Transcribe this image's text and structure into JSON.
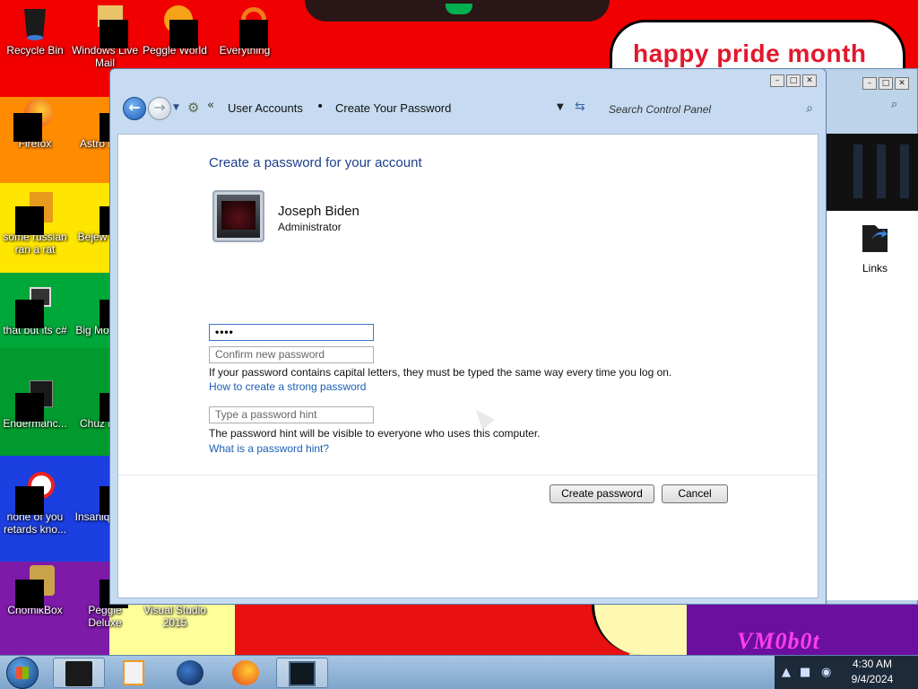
{
  "wallpaper": {
    "speech_text": "happy pride month",
    "corner_text": "VM0b0t"
  },
  "desktop_icons": [
    {
      "label": "Recycle Bin"
    },
    {
      "label": "Windows Live Mail"
    },
    {
      "label": "Peggle World"
    },
    {
      "label": "Everything"
    },
    {
      "label": "Firefox"
    },
    {
      "label": "Astro Delu"
    },
    {
      "label": "some russian ran a rat"
    },
    {
      "label": "Bejew Delu"
    },
    {
      "label": "that but its c#"
    },
    {
      "label": "Big Mo Delu"
    },
    {
      "label": "Endermanc..."
    },
    {
      "label": "Chuz Delu"
    },
    {
      "label": "none of you retards kno..."
    },
    {
      "label": "Insaniq Delu"
    },
    {
      "label": "ChomikBox"
    },
    {
      "label": "Peggle Deluxe"
    },
    {
      "label": "Visual Studio 2015"
    }
  ],
  "back_window": {
    "links_label": "Links"
  },
  "window": {
    "controls": {
      "minimize": "–",
      "maximize": "□",
      "close": "✕"
    },
    "breadcrumb": [
      "User Accounts",
      "Create Your Password"
    ],
    "search_placeholder": "Search Control Panel",
    "heading": "Create a password for your account",
    "user": {
      "name": "Joseph Biden",
      "role": "Administrator"
    },
    "password_value": "••••",
    "confirm_placeholder": "Confirm new password",
    "capital_note": "If your password contains capital letters, they must be typed the same way every time you log on.",
    "strong_link": "How to create a strong password",
    "hint_placeholder": "Type a password hint",
    "hint_note": "The password hint will be visible to everyone who uses this computer.",
    "hint_link": "What is a password hint?",
    "create_button": "Create password",
    "cancel_button": "Cancel"
  },
  "taskbar": {
    "time": "4:30 AM",
    "date": "9/4/2024"
  }
}
